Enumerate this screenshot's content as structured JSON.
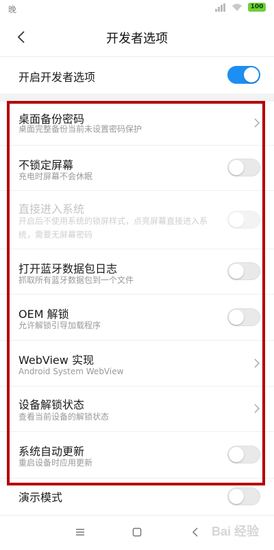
{
  "status_bar": {
    "time": "晚",
    "battery": "100"
  },
  "header": {
    "title": "开发者选项"
  },
  "master_toggle": {
    "label": "开启开发者选项",
    "state": "on"
  },
  "settings": [
    {
      "label": "桌面备份密码",
      "sub": "桌面完整备份当前未设置密码保护",
      "control": "chevron"
    },
    {
      "label": "不锁定屏幕",
      "sub": "充电时屏幕不会休眠",
      "control": "toggle-off"
    },
    {
      "label": "直接进入系统",
      "sub": "开启后不使用系统的锁屏样式，点亮屏幕直接进入系统，需要无屏幕密码",
      "control": "toggle-disabled"
    },
    {
      "label": "打开蓝牙数据包日志",
      "sub": "抓取所有蓝牙数据包到一个文件",
      "control": "toggle-off"
    },
    {
      "label": "OEM 解锁",
      "sub": "允许解锁引导加载程序",
      "control": "toggle-off"
    },
    {
      "label": "WebView 实现",
      "sub": "Android System WebView",
      "control": "chevron"
    },
    {
      "label": "设备解锁状态",
      "sub": "查看当前设备的解锁状态",
      "control": "chevron"
    },
    {
      "label": "系统自动更新",
      "sub": "重启设备时应用更新",
      "control": "toggle-off"
    },
    {
      "label": "演示模式",
      "control": "toggle-off"
    }
  ],
  "watermark": "Bai 经验",
  "colors": {
    "accent": "#1d8ff2",
    "highlight_box": "#b50000"
  }
}
